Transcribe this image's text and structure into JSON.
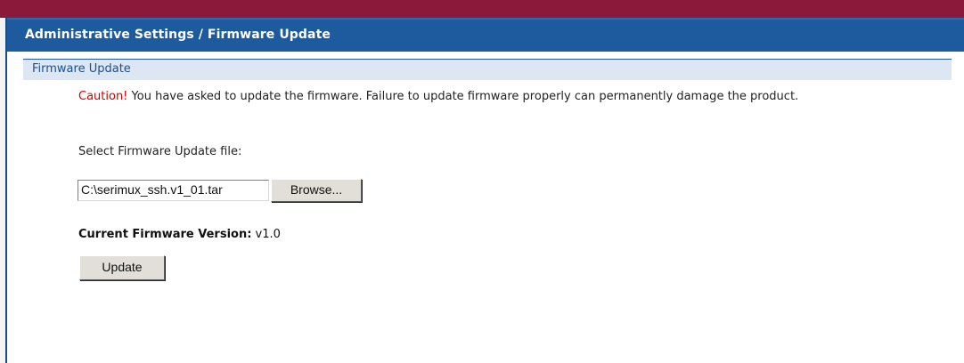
{
  "header": {
    "title": "Administrative Settings / Firmware Update"
  },
  "section": {
    "title": "Firmware Update"
  },
  "caution": {
    "word": "Caution!",
    "message": " You have asked to update the firmware. Failure to update firmware properly can permanently damage the product."
  },
  "form": {
    "select_label": "Select Firmware Update file:",
    "file_value": "C:\\serimux_ssh.v1_01.tar",
    "browse_label": "Browse...",
    "version_label": "Current Firmware Version:",
    "version_value": " v1.0",
    "update_label": "Update"
  },
  "colors": {
    "brand_red": "#8b1a3a",
    "header_blue": "#1d5a9e",
    "section_bg": "#dde7f3",
    "caution_red": "#d40000"
  }
}
